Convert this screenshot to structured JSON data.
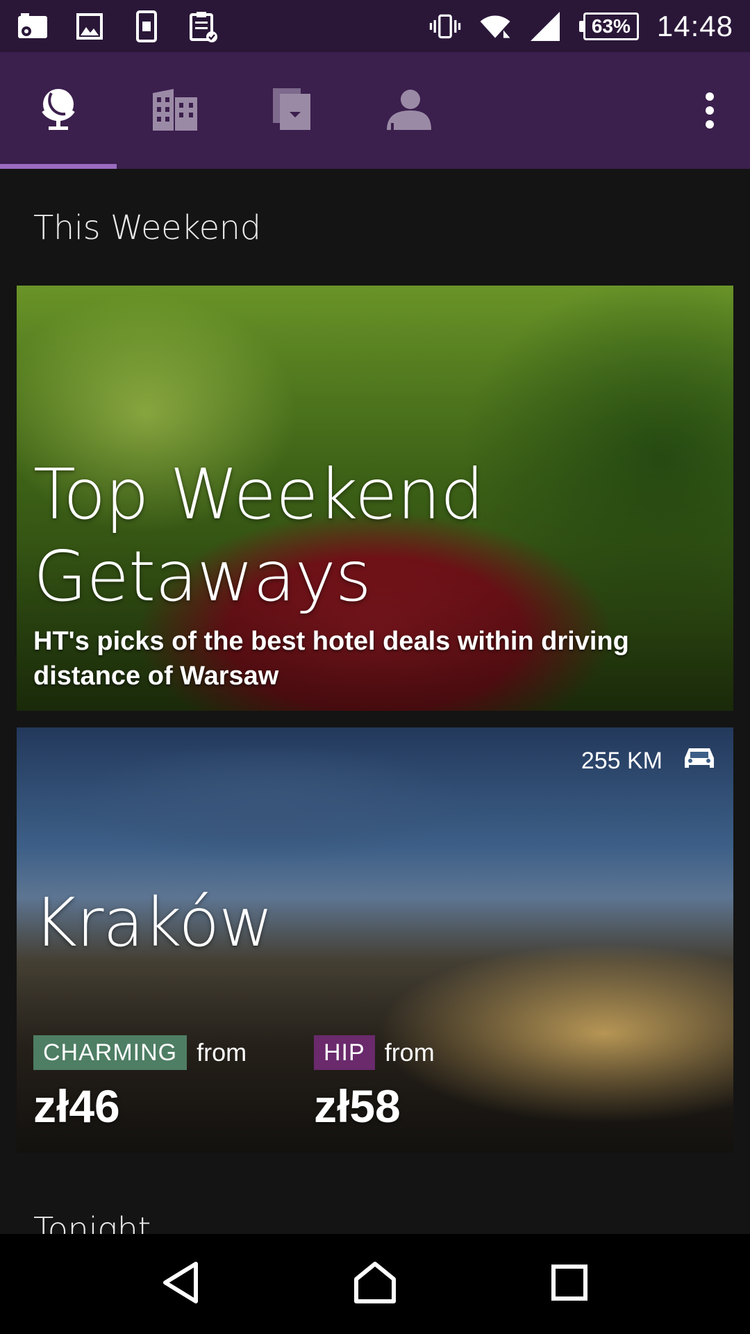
{
  "status_bar": {
    "battery_percent": "63%",
    "time": "14:48",
    "left_icons": [
      "photo-notification-icon",
      "image-icon",
      "phone-icon",
      "clipboard-check-icon"
    ],
    "right_icons": [
      "vibrate-icon",
      "wifi-icon",
      "signal-icon",
      "battery-icon"
    ]
  },
  "tabs": [
    {
      "name": "globe-icon",
      "selected": true
    },
    {
      "name": "building-icon",
      "selected": false
    },
    {
      "name": "booking-icon",
      "selected": false
    },
    {
      "name": "person-icon",
      "selected": false
    }
  ],
  "sections": {
    "weekend": {
      "title": "This Weekend"
    },
    "tonight": {
      "title": "Tonight"
    }
  },
  "feature_card": {
    "title": "Top Weekend Getaways",
    "subtitle": "HT's picks of the best hotel deals within driving distance of Warsaw"
  },
  "city_card": {
    "distance": "255 KM",
    "city": "Kraków",
    "deals": [
      {
        "badge": "CHARMING",
        "from": "from",
        "price": "zł46",
        "color": "#4e7e64"
      },
      {
        "badge": "HIP",
        "from": "from",
        "price": "zł58",
        "color": "#6a2a6c"
      }
    ]
  },
  "colors": {
    "status_bar": "#2a1738",
    "tab_bar": "#3b1f4d",
    "tab_indicator": "#9a6bc0",
    "background": "#141414"
  }
}
